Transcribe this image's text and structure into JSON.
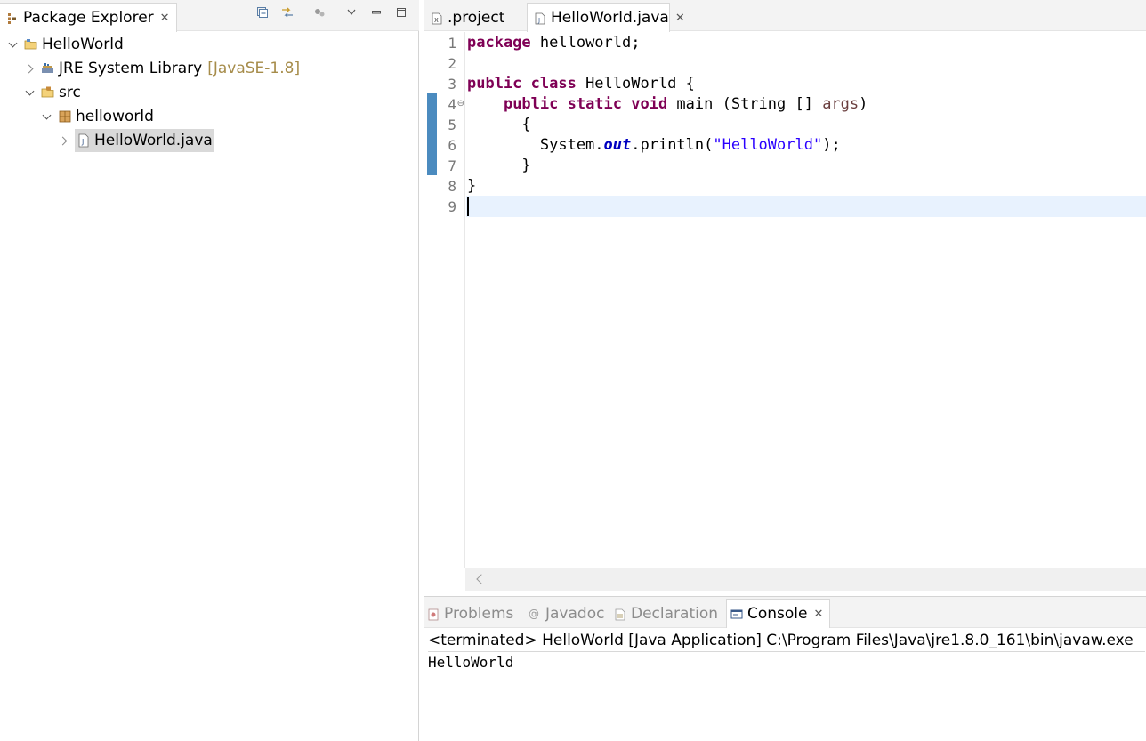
{
  "explorer": {
    "title": "Package Explorer",
    "close": "✕",
    "tree": [
      {
        "label": "HelloWorld",
        "decoration": ""
      },
      {
        "label": "JRE System Library",
        "decoration": "[JavaSE-1.8]"
      },
      {
        "label": "src",
        "decoration": ""
      },
      {
        "label": "helloworld",
        "decoration": ""
      },
      {
        "label": "HelloWorld.java",
        "decoration": ""
      }
    ]
  },
  "editor": {
    "tabs": [
      {
        "label": ".project"
      },
      {
        "label": "HelloWorld.java",
        "close": "✕"
      }
    ],
    "line_numbers": [
      "1",
      "2",
      "3",
      "4",
      "5",
      "6",
      "7",
      "8",
      "9"
    ],
    "fold_marker": "⊖",
    "code": {
      "l1_kw": "package",
      "l1_rest": " helloworld;",
      "l3_kw": "public class",
      "l3_rest": " HelloWorld {",
      "l4_indent": "    ",
      "l4_kw": "public static void",
      "l4_rest": " main (String [] ",
      "l4_param": "args",
      "l4_end": ")",
      "l5": "      {",
      "l6_pre": "        System.",
      "l6_field": "out",
      "l6_mid": ".println(",
      "l6_str": "\"HelloWorld\"",
      "l6_end": ");",
      "l7": "      }",
      "l8": "}"
    }
  },
  "console_panel": {
    "tabs": [
      {
        "label": "Problems"
      },
      {
        "label": "Javadoc"
      },
      {
        "label": "Declaration"
      },
      {
        "label": "Console",
        "close": "✕"
      }
    ],
    "status": "<terminated> HelloWorld [Java Application] C:\\Program Files\\Java\\jre1.8.0_161\\bin\\javaw.exe",
    "output": "HelloWorld"
  }
}
